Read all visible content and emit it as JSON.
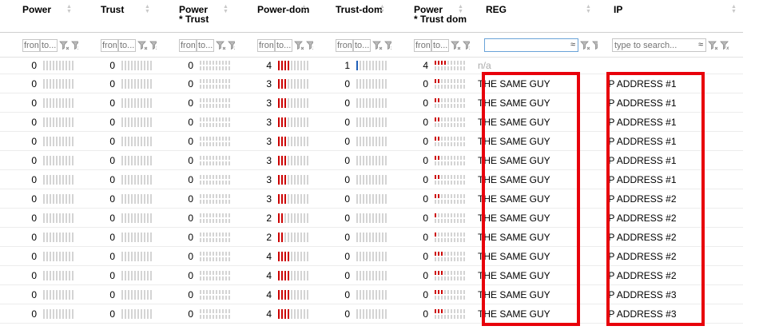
{
  "columns": [
    {
      "label": "Power",
      "sub": ""
    },
    {
      "label": "Trust",
      "sub": ""
    },
    {
      "label": "Power",
      "sub": "* Trust"
    },
    {
      "label": "Power-dom",
      "sub": ""
    },
    {
      "label": "Trust-dom",
      "sub": ""
    },
    {
      "label": "Power",
      "sub": "* Trust dom"
    },
    {
      "label": "REG",
      "sub": ""
    },
    {
      "label": "IP",
      "sub": ""
    }
  ],
  "filters": {
    "range_from_placeholder": "from",
    "range_to_placeholder": "to...",
    "reg_search_value": "",
    "ip_search_placeholder": "type to search...",
    "approx_symbol": "≈"
  },
  "first_row": {
    "power": "0",
    "trust": "0",
    "pt": "0",
    "pdom": "4",
    "tdom": "1",
    "ptdom": "4",
    "reg": "n/a",
    "ip": ""
  },
  "rows": [
    {
      "power": "0",
      "trust": "0",
      "pt": "0",
      "pdom": "3",
      "tdom": "0",
      "ptdom": "0",
      "reg": "THE SAME GUY",
      "ip": "IP ADDRESS #1"
    },
    {
      "power": "0",
      "trust": "0",
      "pt": "0",
      "pdom": "3",
      "tdom": "0",
      "ptdom": "0",
      "reg": "THE SAME GUY",
      "ip": "IP ADDRESS #1"
    },
    {
      "power": "0",
      "trust": "0",
      "pt": "0",
      "pdom": "3",
      "tdom": "0",
      "ptdom": "0",
      "reg": "THE SAME GUY",
      "ip": "IP ADDRESS #1"
    },
    {
      "power": "0",
      "trust": "0",
      "pt": "0",
      "pdom": "3",
      "tdom": "0",
      "ptdom": "0",
      "reg": "THE SAME GUY",
      "ip": "IP ADDRESS #1"
    },
    {
      "power": "0",
      "trust": "0",
      "pt": "0",
      "pdom": "3",
      "tdom": "0",
      "ptdom": "0",
      "reg": "THE SAME GUY",
      "ip": "IP ADDRESS #1"
    },
    {
      "power": "0",
      "trust": "0",
      "pt": "0",
      "pdom": "3",
      "tdom": "0",
      "ptdom": "0",
      "reg": "THE SAME GUY",
      "ip": "IP ADDRESS #1"
    },
    {
      "power": "0",
      "trust": "0",
      "pt": "0",
      "pdom": "3",
      "tdom": "0",
      "ptdom": "0",
      "reg": "THE SAME GUY",
      "ip": "IP ADDRESS #2"
    },
    {
      "power": "0",
      "trust": "0",
      "pt": "0",
      "pdom": "2",
      "tdom": "0",
      "ptdom": "0",
      "reg": "THE SAME GUY",
      "ip": "IP ADDRESS #2"
    },
    {
      "power": "0",
      "trust": "0",
      "pt": "0",
      "pdom": "2",
      "tdom": "0",
      "ptdom": "0",
      "reg": "THE SAME GUY",
      "ip": "IP ADDRESS #2"
    },
    {
      "power": "0",
      "trust": "0",
      "pt": "0",
      "pdom": "4",
      "tdom": "0",
      "ptdom": "0",
      "reg": "THE SAME GUY",
      "ip": "IP ADDRESS #2"
    },
    {
      "power": "0",
      "trust": "0",
      "pt": "0",
      "pdom": "4",
      "tdom": "0",
      "ptdom": "0",
      "reg": "THE SAME GUY",
      "ip": "IP ADDRESS #2"
    },
    {
      "power": "0",
      "trust": "0",
      "pt": "0",
      "pdom": "4",
      "tdom": "0",
      "ptdom": "0",
      "reg": "THE SAME GUY",
      "ip": "IP ADDRESS #3"
    },
    {
      "power": "0",
      "trust": "0",
      "pt": "0",
      "pdom": "4",
      "tdom": "0",
      "ptdom": "0",
      "reg": "THE SAME GUY",
      "ip": "IP ADDRESS #3"
    }
  ],
  "colors": {
    "bar_on": "#cc0000",
    "bar_trust_on": "#1f5fb8",
    "bar_off": "#d4d4d4",
    "highlight": "#e8000b"
  }
}
